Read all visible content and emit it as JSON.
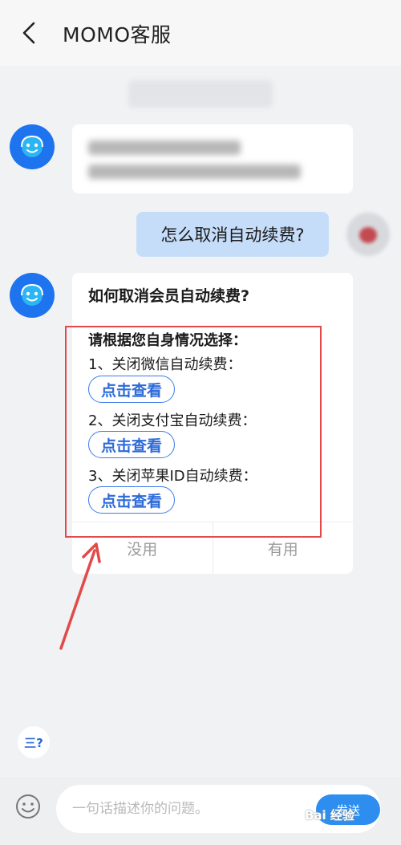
{
  "header": {
    "title": "MOMO客服"
  },
  "chat": {
    "user_message": "怎么取消自动续费?",
    "answer": {
      "title": "如何取消会员自动续费?",
      "intro": "请根据您自身情况选择：",
      "options": [
        {
          "label": "1、关闭微信自动续费：",
          "button": "点击查看"
        },
        {
          "label": "2、关闭支付宝自动续费：",
          "button": "点击查看"
        },
        {
          "label": "3、关闭苹果ID自动续费：",
          "button": "点击查看"
        }
      ],
      "feedback": {
        "useless": "没用",
        "useful": "有用"
      }
    }
  },
  "faq_label": "三?",
  "input": {
    "placeholder": "一句话描述你的问题。"
  },
  "send_label": "发送",
  "watermark": "Bai 经验",
  "colors": {
    "accent": "#1e73ee",
    "link": "#2d6ad8",
    "user_bubble": "#c6ddfa",
    "annotation": "#e24a4a"
  }
}
